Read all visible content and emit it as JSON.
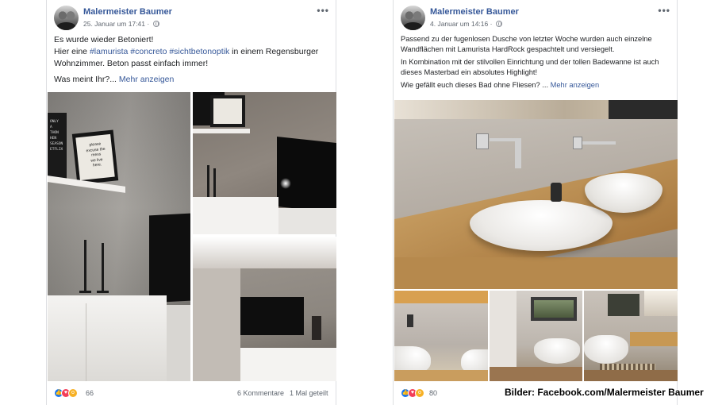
{
  "posts": [
    {
      "author": "Malermeister Baumer",
      "timestamp": "25. Januar um 17:41 ·",
      "text_line1": "Es wurde wieder Betoniert!",
      "text_line2_prefix": "Hier eine ",
      "hashtags": "#lamurista #concreto #sichtbetonoptik",
      "text_line2_suffix": " in einem Regensburger Wohnzimmer. Beton passt einfach immer!",
      "question": "Was meint Ihr?...",
      "see_more": "Mehr anzeigen",
      "reaction_count": "66",
      "comments": "6 Kommentare",
      "shares": "1 Mal geteilt",
      "poster_text_1": "ONLY\nA\nTHON\nHEN\nSEASON\nETFLIX",
      "poster_text_2": "please\nexcuse the\nmess\nwe live\nhere."
    },
    {
      "author": "Malermeister Baumer",
      "timestamp": "4. Januar um 14:16 ·",
      "para1": "Passend zu der fugenlosen Dusche von letzter Woche wurden auch einzelne Wandflächen mit Lamurista HardRock gespachtelt und versiegelt.",
      "para2": "In Kombination mit der stilvollen Einrichtung und der tollen Badewanne ist auch dieses Masterbad ein absolutes Highlight!",
      "question": "Wie gefällt euch dieses Bad ohne Fliesen? ...",
      "see_more": "Mehr anzeigen",
      "reaction_count": "80"
    }
  ],
  "credit": "Bilder: Facebook.com/Malermeister Baumer",
  "icons": {
    "more": "more-options-icon",
    "globe": "globe-icon",
    "like": "like-reaction-icon",
    "love": "love-reaction-icon",
    "wow": "wow-reaction-icon"
  },
  "colors": {
    "link": "#365899",
    "like": "#1877f2",
    "love": "#f33e58",
    "wow": "#f7b125"
  }
}
